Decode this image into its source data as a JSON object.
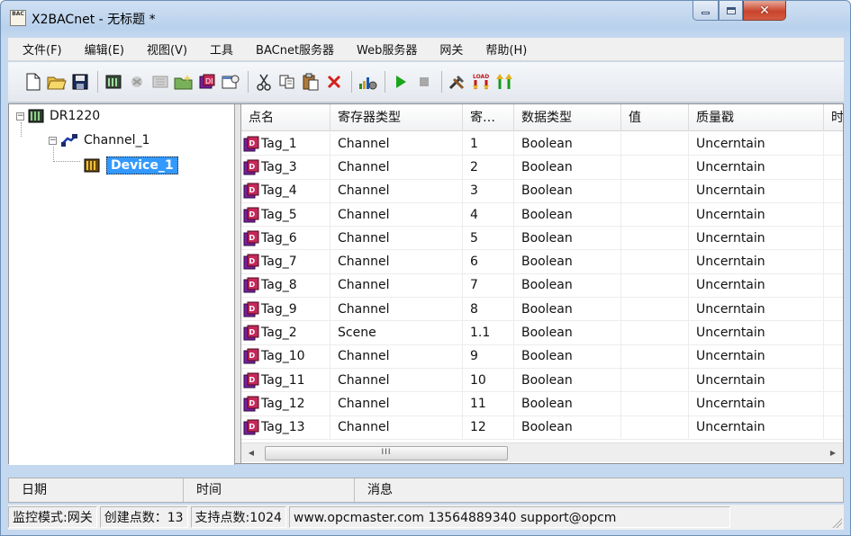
{
  "window": {
    "title": "X2BACnet - 无标题 *",
    "icon_label": "BAC"
  },
  "menu": [
    "文件(F)",
    "编辑(E)",
    "视图(V)",
    "工具",
    "BACnet服务器",
    "Web服务器",
    "网关",
    "帮助(H)"
  ],
  "toolbar": {
    "icons": [
      "new-icon",
      "open-icon",
      "save-icon",
      "add-channel-icon",
      "add-device-icon",
      "add-tag-icon",
      "new-folder-icon",
      "import-icon",
      "properties-icon",
      "cut-icon",
      "copy-icon",
      "paste-icon",
      "delete-icon",
      "monitor-icon",
      "run-icon",
      "stop-icon",
      "tools-icon",
      "load-icon",
      "upload-icon"
    ],
    "load_text": "LOAD"
  },
  "tree": {
    "root": "DR1220",
    "channel": "Channel_1",
    "device": "Device_1",
    "expand_symbol": "−"
  },
  "table": {
    "headers": [
      "点名",
      "寄存器类型",
      "寄…",
      "数据类型",
      "值",
      "质量戳",
      "时"
    ],
    "rows": [
      [
        "Tag_1",
        "Channel",
        "1",
        "Boolean",
        "",
        "Uncerntain"
      ],
      [
        "Tag_3",
        "Channel",
        "2",
        "Boolean",
        "",
        "Uncerntain"
      ],
      [
        "Tag_4",
        "Channel",
        "3",
        "Boolean",
        "",
        "Uncerntain"
      ],
      [
        "Tag_5",
        "Channel",
        "4",
        "Boolean",
        "",
        "Uncerntain"
      ],
      [
        "Tag_6",
        "Channel",
        "5",
        "Boolean",
        "",
        "Uncerntain"
      ],
      [
        "Tag_7",
        "Channel",
        "6",
        "Boolean",
        "",
        "Uncerntain"
      ],
      [
        "Tag_8",
        "Channel",
        "7",
        "Boolean",
        "",
        "Uncerntain"
      ],
      [
        "Tag_9",
        "Channel",
        "8",
        "Boolean",
        "",
        "Uncerntain"
      ],
      [
        "Tag_2",
        "Scene",
        "1.1",
        "Boolean",
        "",
        "Uncerntain"
      ],
      [
        "Tag_10",
        "Channel",
        "9",
        "Boolean",
        "",
        "Uncerntain"
      ],
      [
        "Tag_11",
        "Channel",
        "10",
        "Boolean",
        "",
        "Uncerntain"
      ],
      [
        "Tag_12",
        "Channel",
        "11",
        "Boolean",
        "",
        "Uncerntain"
      ],
      [
        "Tag_13",
        "Channel",
        "12",
        "Boolean",
        "",
        "Uncerntain"
      ]
    ],
    "scroll_grip": "III"
  },
  "log": {
    "headers": [
      "日期",
      "时间",
      "消息"
    ]
  },
  "status": {
    "mode": "监控模式:网关",
    "created": "创建点数：13",
    "supported": "支持点数:1024",
    "contact": "www.opcmaster.com 13564889340 support@opcm"
  },
  "colors": {
    "selection": "#3399ff",
    "title_gradient_top": "#cfe0f3",
    "close_button": "#c8452c"
  }
}
